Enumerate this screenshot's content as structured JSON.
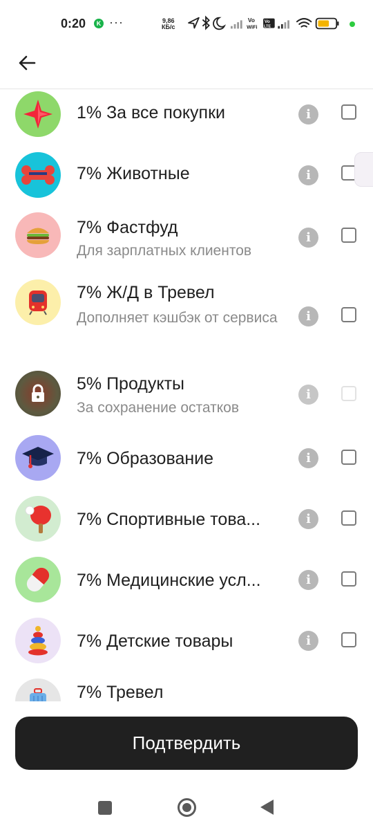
{
  "status_bar": {
    "time": "0:20",
    "k_badge": "K",
    "dots": "···",
    "speed_value": "9,86",
    "speed_unit": "КБ/c",
    "volte1": "Vo WiFi",
    "volte2": "Vo LTE",
    "icons": [
      "location-arrow-icon",
      "bluetooth-icon",
      "moon-icon",
      "signal-icon",
      "wifi-icon",
      "battery-icon"
    ]
  },
  "header": {
    "back_icon": "arrow-left-icon"
  },
  "categories": [
    {
      "title": "1% За все покупки",
      "subtitle": "",
      "icon": "red-star-icon",
      "icon_bg": "#8ed86a",
      "checked": false,
      "disabled": false
    },
    {
      "title": "7% Животные",
      "subtitle": "",
      "icon": "bone-icon",
      "icon_bg": "#18c3da",
      "checked": false,
      "disabled": false
    },
    {
      "title": "7% Фастфуд",
      "subtitle": "Для зарплатных клиентов",
      "icon": "burger-icon",
      "icon_bg": "#f8b8b8",
      "checked": false,
      "disabled": false
    },
    {
      "title": "7% Ж/Д в Тревел",
      "subtitle": "Дополняет кэшбэк от сервиса",
      "icon": "train-icon",
      "icon_bg": "#fcefaa",
      "checked": false,
      "disabled": false
    },
    {
      "title": "5% Продукты",
      "subtitle": "За сохранение остатков",
      "icon": "lock-icon",
      "icon_bg": "#5d5a40",
      "checked": false,
      "disabled": true
    },
    {
      "title": "7% Образование",
      "subtitle": "",
      "icon": "graduation-cap-icon",
      "icon_bg": "#a8a8f2",
      "checked": false,
      "disabled": false
    },
    {
      "title": "7% Спортивные това...",
      "subtitle": "",
      "icon": "ping-pong-icon",
      "icon_bg": "#d2ecd0",
      "checked": false,
      "disabled": false
    },
    {
      "title": "7% Медицинские усл...",
      "subtitle": "",
      "icon": "pill-icon",
      "icon_bg": "#a8e69a",
      "checked": false,
      "disabled": false
    },
    {
      "title": "7% Детские товары",
      "subtitle": "",
      "icon": "toy-pyramid-icon",
      "icon_bg": "#ece2f6",
      "checked": false,
      "disabled": false
    },
    {
      "title": "7% Тревел",
      "subtitle": "",
      "icon": "suitcase-icon",
      "icon_bg": "#e6e6e6",
      "checked": false,
      "disabled": false
    }
  ],
  "info_glyph": "i",
  "confirm_label": "Подтвердить",
  "nav": {
    "icons": [
      "recents-square-icon",
      "home-circle-icon",
      "back-triangle-icon"
    ]
  }
}
